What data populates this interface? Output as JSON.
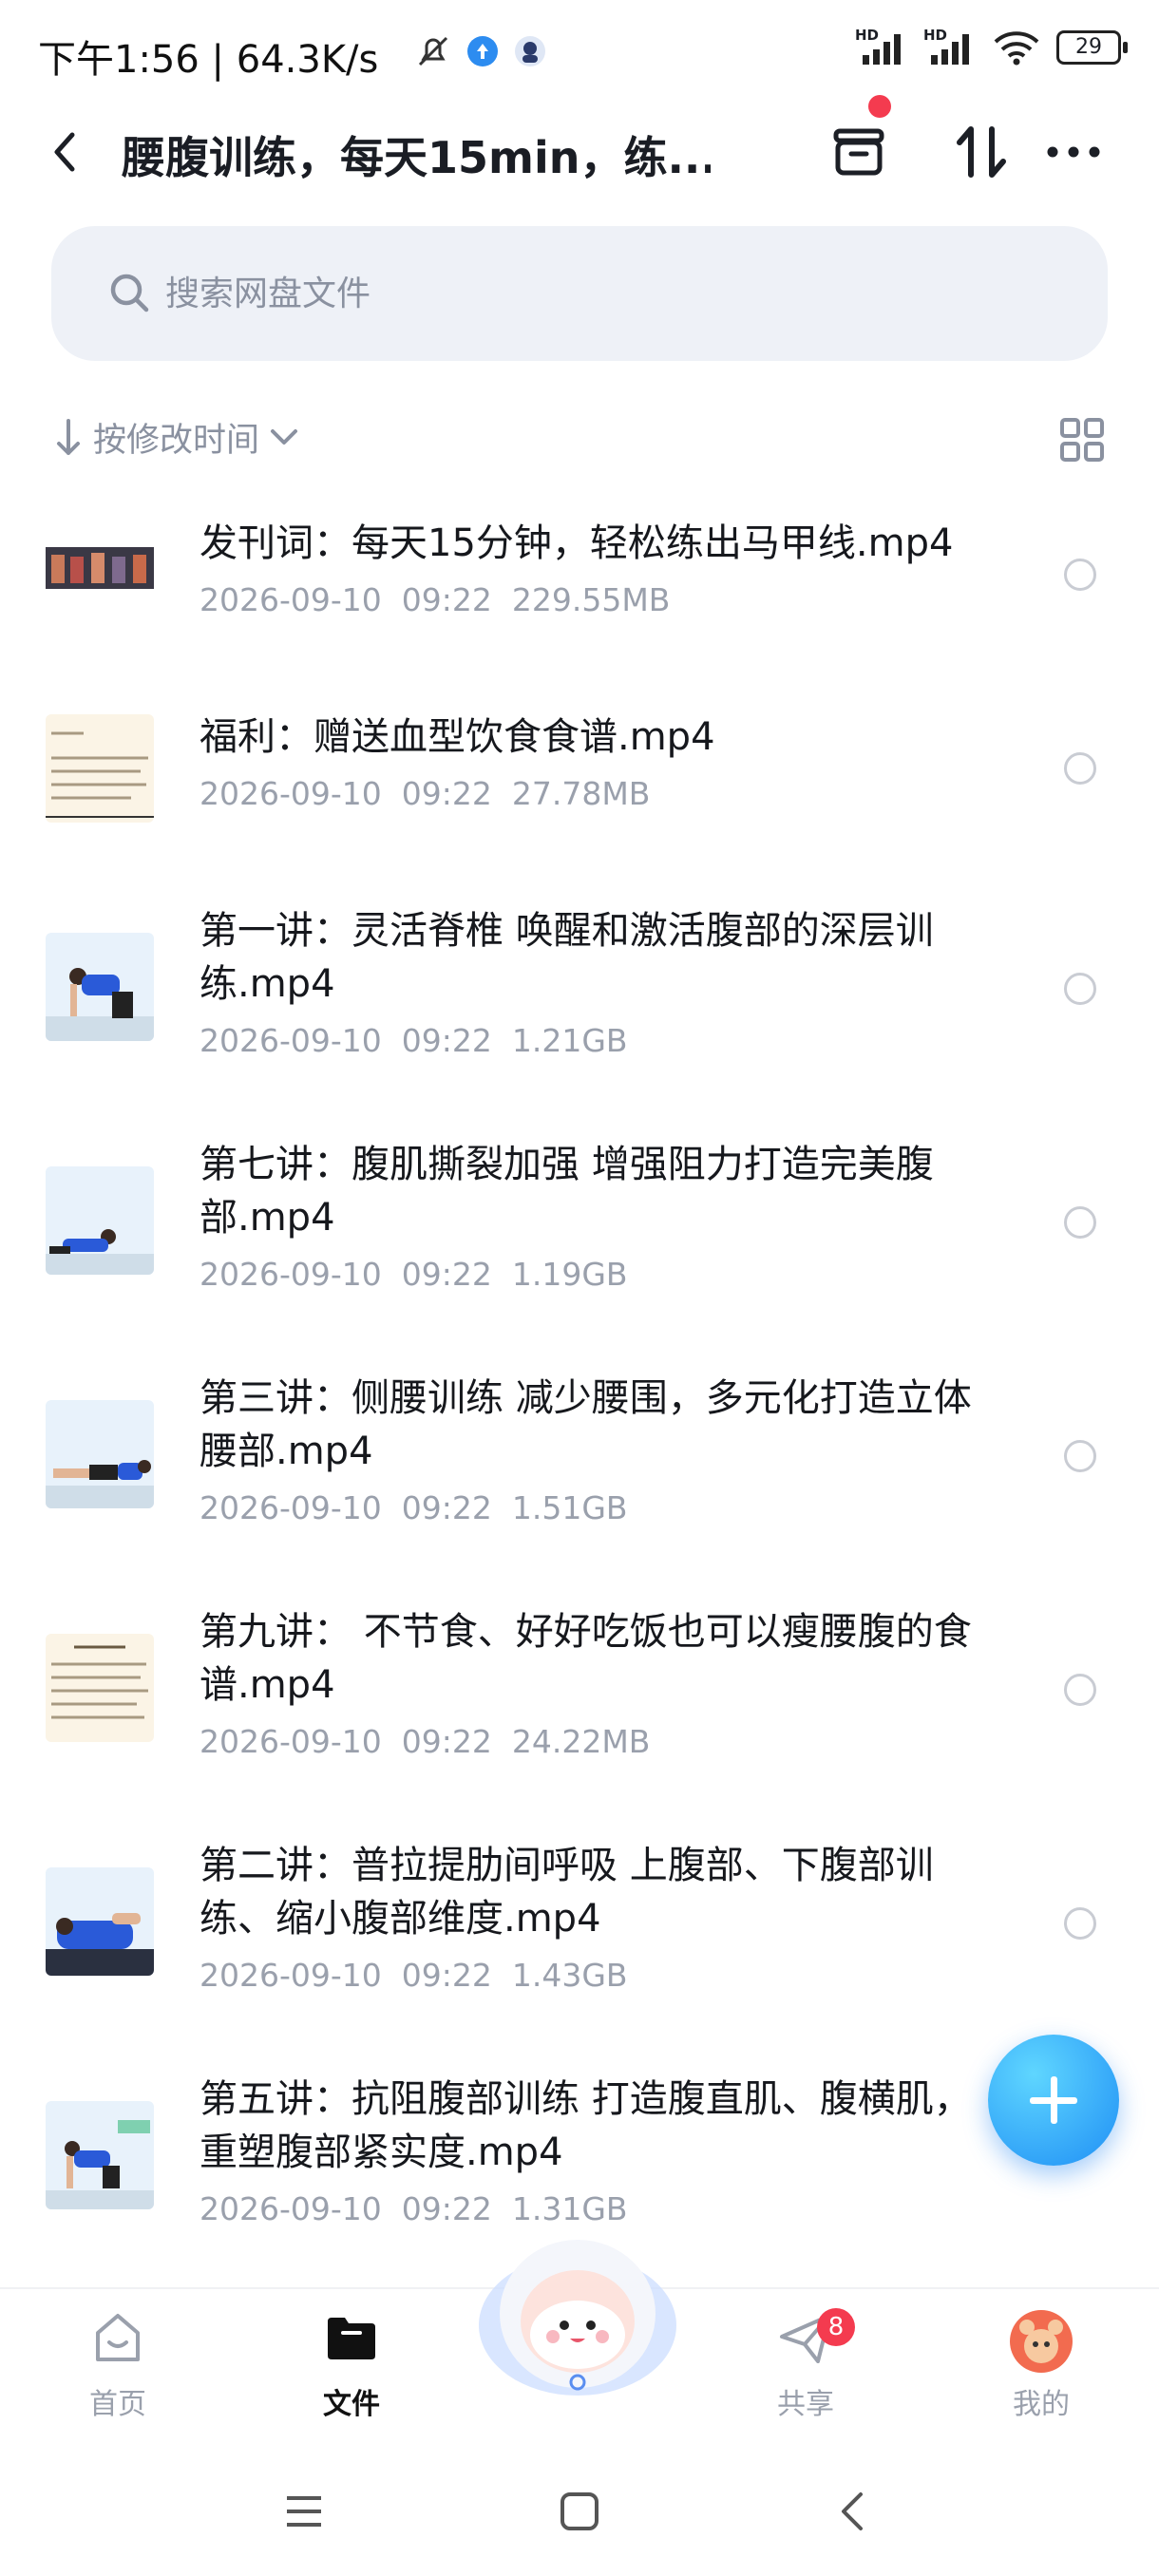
{
  "status_bar": {
    "time": "下午1:56",
    "net_speed": "64.3K/s",
    "separator": "|",
    "signal1_label": "HD",
    "signal2_label": "HD",
    "battery": "29"
  },
  "header": {
    "title": "腰腹训练，每天15min，练...",
    "back_icon": "chevron-left-icon",
    "transfer_icon": "box-icon",
    "sort_icon": "up-down-arrows-icon",
    "more_icon": "more-dots-icon"
  },
  "search": {
    "placeholder": "搜索网盘文件",
    "value": ""
  },
  "sort": {
    "label": "按修改时间",
    "view_icon": "grid-view-icon"
  },
  "files": [
    {
      "name": "发刊词：每天15分钟，轻松练出马甲线.mp4",
      "date": "2026-09-10",
      "time": "09:22",
      "size": "229.55MB",
      "thumb": "group-photo"
    },
    {
      "name": "福利：赠送血型饮食食谱.mp4",
      "date": "2026-09-10",
      "time": "09:22",
      "size": "27.78MB",
      "thumb": "document"
    },
    {
      "name": "第一讲：灵活脊椎 唤醒和激活腹部的深层训练.mp4",
      "date": "2026-09-10",
      "time": "09:22",
      "size": "1.21GB",
      "thumb": "exercise"
    },
    {
      "name": "第七讲：腹肌撕裂加强 增强阻力打造完美腹部.mp4",
      "date": "2026-09-10",
      "time": "09:22",
      "size": "1.19GB",
      "thumb": "exercise"
    },
    {
      "name": "第三讲：侧腰训练 减少腰围，多元化打造立体腰部.mp4",
      "date": "2026-09-10",
      "time": "09:22",
      "size": "1.51GB",
      "thumb": "exercise"
    },
    {
      "name": "第九讲： 不节食、好好吃饭也可以瘦腰腹的食谱.mp4",
      "date": "2026-09-10",
      "time": "09:22",
      "size": "24.22MB",
      "thumb": "document"
    },
    {
      "name": "第二讲：普拉提肋间呼吸 上腹部、下腹部训练、缩小腹部维度.mp4",
      "date": "2026-09-10",
      "time": "09:22",
      "size": "1.43GB",
      "thumb": "exercise"
    },
    {
      "name": "第五讲：抗阻腹部训练 打造腹直肌、腹横肌，重塑腹部紧实度.mp4",
      "date": "2026-09-10",
      "time": "09:22",
      "size": "1.31GB",
      "thumb": "exercise"
    }
  ],
  "fab": {
    "icon": "plus-icon"
  },
  "bottom_nav": [
    {
      "label": "首页",
      "icon": "home-icon",
      "active": false
    },
    {
      "label": "文件",
      "icon": "folder-icon",
      "active": true
    },
    {
      "label": "共享",
      "icon": "paper-plane-icon",
      "active": false,
      "badge": "8"
    },
    {
      "label": "我的",
      "icon": "avatar-icon",
      "active": false
    }
  ],
  "system_nav": {
    "menu_icon": "menu-icon",
    "home_icon": "square-icon",
    "back_icon": "back-icon"
  },
  "colors": {
    "accent": "#1f8ff5",
    "badge": "#f43b4f",
    "meta_text": "#9aa0ac"
  }
}
